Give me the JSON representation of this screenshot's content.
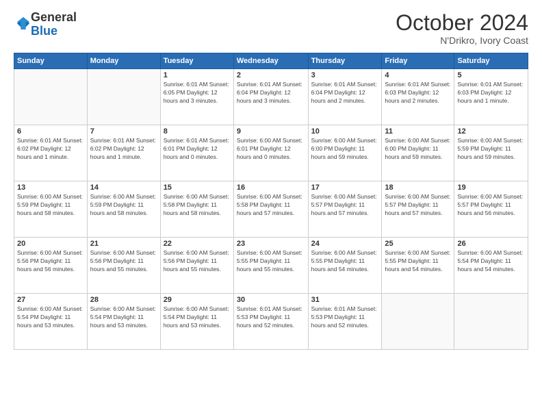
{
  "header": {
    "logo": {
      "general": "General",
      "blue": "Blue"
    },
    "title": "October 2024",
    "location": "N'Drikro, Ivory Coast"
  },
  "days_header": [
    "Sunday",
    "Monday",
    "Tuesday",
    "Wednesday",
    "Thursday",
    "Friday",
    "Saturday"
  ],
  "weeks": [
    [
      {
        "day": "",
        "info": ""
      },
      {
        "day": "",
        "info": ""
      },
      {
        "day": "1",
        "info": "Sunrise: 6:01 AM\nSunset: 6:05 PM\nDaylight: 12 hours\nand 3 minutes."
      },
      {
        "day": "2",
        "info": "Sunrise: 6:01 AM\nSunset: 6:04 PM\nDaylight: 12 hours\nand 3 minutes."
      },
      {
        "day": "3",
        "info": "Sunrise: 6:01 AM\nSunset: 6:04 PM\nDaylight: 12 hours\nand 2 minutes."
      },
      {
        "day": "4",
        "info": "Sunrise: 6:01 AM\nSunset: 6:03 PM\nDaylight: 12 hours\nand 2 minutes."
      },
      {
        "day": "5",
        "info": "Sunrise: 6:01 AM\nSunset: 6:03 PM\nDaylight: 12 hours\nand 1 minute."
      }
    ],
    [
      {
        "day": "6",
        "info": "Sunrise: 6:01 AM\nSunset: 6:02 PM\nDaylight: 12 hours\nand 1 minute."
      },
      {
        "day": "7",
        "info": "Sunrise: 6:01 AM\nSunset: 6:02 PM\nDaylight: 12 hours\nand 1 minute."
      },
      {
        "day": "8",
        "info": "Sunrise: 6:01 AM\nSunset: 6:01 PM\nDaylight: 12 hours\nand 0 minutes."
      },
      {
        "day": "9",
        "info": "Sunrise: 6:00 AM\nSunset: 6:01 PM\nDaylight: 12 hours\nand 0 minutes."
      },
      {
        "day": "10",
        "info": "Sunrise: 6:00 AM\nSunset: 6:00 PM\nDaylight: 11 hours\nand 59 minutes."
      },
      {
        "day": "11",
        "info": "Sunrise: 6:00 AM\nSunset: 6:00 PM\nDaylight: 11 hours\nand 59 minutes."
      },
      {
        "day": "12",
        "info": "Sunrise: 6:00 AM\nSunset: 5:59 PM\nDaylight: 11 hours\nand 59 minutes."
      }
    ],
    [
      {
        "day": "13",
        "info": "Sunrise: 6:00 AM\nSunset: 5:59 PM\nDaylight: 11 hours\nand 58 minutes."
      },
      {
        "day": "14",
        "info": "Sunrise: 6:00 AM\nSunset: 5:59 PM\nDaylight: 11 hours\nand 58 minutes."
      },
      {
        "day": "15",
        "info": "Sunrise: 6:00 AM\nSunset: 5:58 PM\nDaylight: 11 hours\nand 58 minutes."
      },
      {
        "day": "16",
        "info": "Sunrise: 6:00 AM\nSunset: 5:58 PM\nDaylight: 11 hours\nand 57 minutes."
      },
      {
        "day": "17",
        "info": "Sunrise: 6:00 AM\nSunset: 5:57 PM\nDaylight: 11 hours\nand 57 minutes."
      },
      {
        "day": "18",
        "info": "Sunrise: 6:00 AM\nSunset: 5:57 PM\nDaylight: 11 hours\nand 57 minutes."
      },
      {
        "day": "19",
        "info": "Sunrise: 6:00 AM\nSunset: 5:57 PM\nDaylight: 11 hours\nand 56 minutes."
      }
    ],
    [
      {
        "day": "20",
        "info": "Sunrise: 6:00 AM\nSunset: 5:56 PM\nDaylight: 11 hours\nand 56 minutes."
      },
      {
        "day": "21",
        "info": "Sunrise: 6:00 AM\nSunset: 5:56 PM\nDaylight: 11 hours\nand 55 minutes."
      },
      {
        "day": "22",
        "info": "Sunrise: 6:00 AM\nSunset: 5:56 PM\nDaylight: 11 hours\nand 55 minutes."
      },
      {
        "day": "23",
        "info": "Sunrise: 6:00 AM\nSunset: 5:55 PM\nDaylight: 11 hours\nand 55 minutes."
      },
      {
        "day": "24",
        "info": "Sunrise: 6:00 AM\nSunset: 5:55 PM\nDaylight: 11 hours\nand 54 minutes."
      },
      {
        "day": "25",
        "info": "Sunrise: 6:00 AM\nSunset: 5:55 PM\nDaylight: 11 hours\nand 54 minutes."
      },
      {
        "day": "26",
        "info": "Sunrise: 6:00 AM\nSunset: 5:54 PM\nDaylight: 11 hours\nand 54 minutes."
      }
    ],
    [
      {
        "day": "27",
        "info": "Sunrise: 6:00 AM\nSunset: 5:54 PM\nDaylight: 11 hours\nand 53 minutes."
      },
      {
        "day": "28",
        "info": "Sunrise: 6:00 AM\nSunset: 5:54 PM\nDaylight: 11 hours\nand 53 minutes."
      },
      {
        "day": "29",
        "info": "Sunrise: 6:00 AM\nSunset: 5:54 PM\nDaylight: 11 hours\nand 53 minutes."
      },
      {
        "day": "30",
        "info": "Sunrise: 6:01 AM\nSunset: 5:53 PM\nDaylight: 11 hours\nand 52 minutes."
      },
      {
        "day": "31",
        "info": "Sunrise: 6:01 AM\nSunset: 5:53 PM\nDaylight: 11 hours\nand 52 minutes."
      },
      {
        "day": "",
        "info": ""
      },
      {
        "day": "",
        "info": ""
      }
    ]
  ]
}
